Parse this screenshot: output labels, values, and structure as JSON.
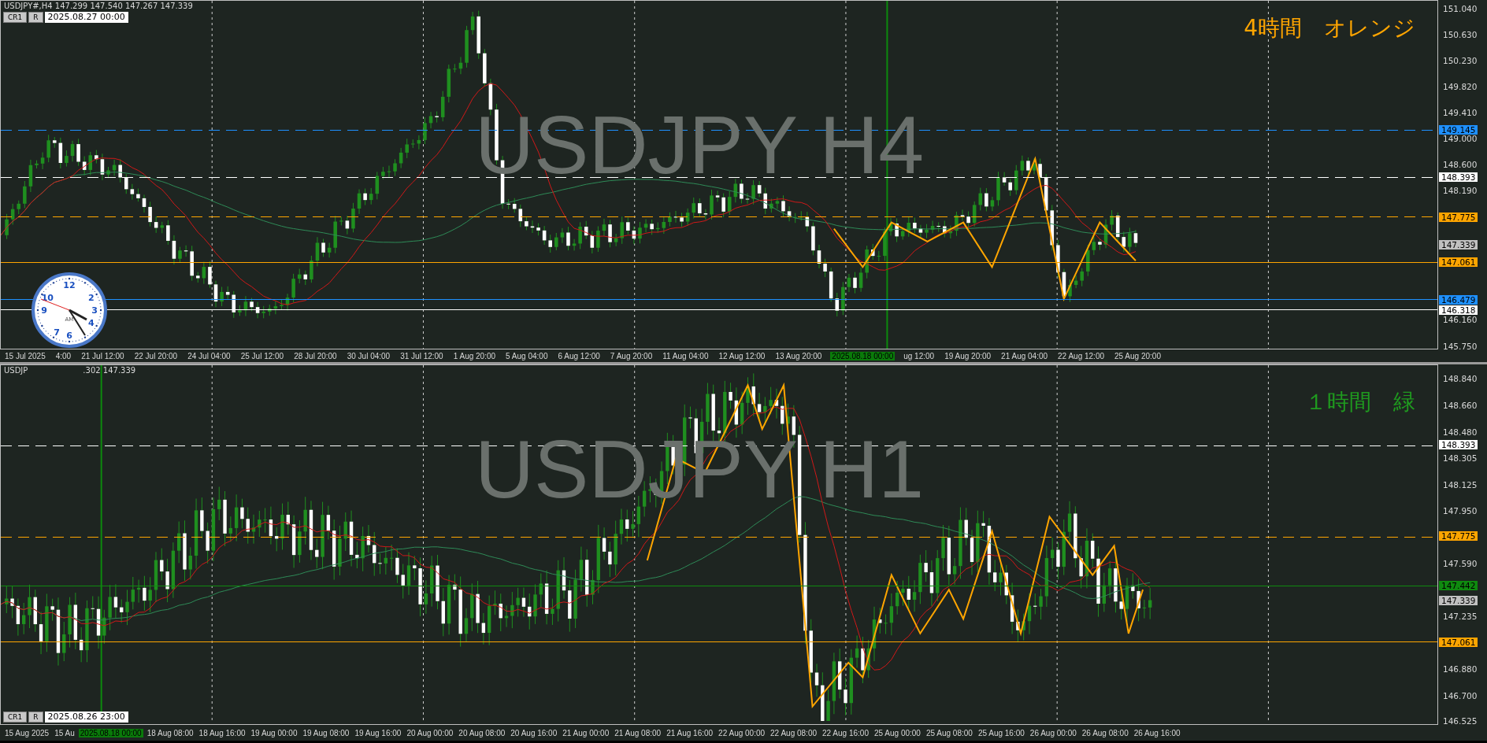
{
  "panels": [
    {
      "header": [
        "USDJPY#,H4  147.299 147.540 147.267 147.339"
      ],
      "watermark": "USDJPY H4",
      "note": {
        "text": "4時間　オレンジ",
        "color": "#ffa500"
      },
      "date_box": {
        "buttons": [
          "CR1",
          "R"
        ],
        "value": "2025.08.27 00:00"
      },
      "price_ticks": [
        "151.040",
        "150.630",
        "150.230",
        "149.820",
        "149.410",
        "149.000",
        "148.600",
        "148.190",
        "146.160",
        "145.750"
      ],
      "levels": [
        {
          "price": "149.145",
          "kind": "dashed",
          "color": "#1e90ff"
        },
        {
          "price": "148.393",
          "kind": "dashed",
          "color": "#ffffff"
        },
        {
          "price": "147.775",
          "kind": "dashed",
          "color": "#ffa500"
        },
        {
          "price": "147.339",
          "kind": "marker",
          "color": "#c0c0c0"
        },
        {
          "price": "147.061",
          "kind": "solid",
          "color": "#ffa500"
        },
        {
          "price": "146.479",
          "kind": "solid",
          "color": "#1e90ff"
        },
        {
          "price": "146.318",
          "kind": "solid",
          "color": "#ffffff"
        }
      ],
      "time_labels": [
        {
          "text": "15 Jul 2025",
          "selected": false
        },
        {
          "text": "4:00",
          "selected": false
        },
        {
          "text": "21 Jul 12:00",
          "selected": false
        },
        {
          "text": "22 Jul 20:00",
          "selected": false
        },
        {
          "text": "24 Jul 04:00",
          "selected": false
        },
        {
          "text": "25 Jul 12:00",
          "selected": false
        },
        {
          "text": "28 Jul 20:00",
          "selected": false
        },
        {
          "text": "30 Jul 04:00",
          "selected": false
        },
        {
          "text": "31 Jul 12:00",
          "selected": false
        },
        {
          "text": "1 Aug 20:00",
          "selected": false
        },
        {
          "text": "5 Aug 04:00",
          "selected": false
        },
        {
          "text": "6 Aug 12:00",
          "selected": false
        },
        {
          "text": "7 Aug 20:00",
          "selected": false
        },
        {
          "text": "11 Aug 04:00",
          "selected": false
        },
        {
          "text": "12 Aug 12:00",
          "selected": false
        },
        {
          "text": "13 Aug 20:00",
          "selected": false
        },
        {
          "text": "2025.08.18 00:00",
          "selected": true
        },
        {
          "text": "ug 12:00",
          "selected": false
        },
        {
          "text": "19 Aug 20:00",
          "selected": false
        },
        {
          "text": "21 Aug 04:00",
          "selected": false
        },
        {
          "text": "22 Aug 12:00",
          "selected": false
        },
        {
          "text": "25 Aug 20:00",
          "selected": false
        }
      ]
    },
    {
      "header": [
        "USDJP",
        ".302 147.339"
      ],
      "watermark": "USDJPY H1",
      "note": {
        "text": "１時間　緑",
        "color": "#1f9a1f"
      },
      "date_box": {
        "buttons": [
          "CR1",
          "R"
        ],
        "value": "2025.08.26 23:00"
      },
      "price_ticks": [
        "148.840",
        "148.660",
        "148.480",
        "148.305",
        "148.125",
        "147.950",
        "147.590",
        "147.235",
        "146.880",
        "146.700",
        "146.525"
      ],
      "levels": [
        {
          "price": "148.393",
          "kind": "dashed",
          "color": "#ffffff"
        },
        {
          "price": "147.775",
          "kind": "dashed",
          "color": "#ffa500"
        },
        {
          "price": "147.442",
          "kind": "solid",
          "color": "#0f8a0f"
        },
        {
          "price": "147.339",
          "kind": "marker",
          "color": "#c0c0c0"
        },
        {
          "price": "147.061",
          "kind": "solid",
          "color": "#ffa500"
        }
      ],
      "time_labels": [
        {
          "text": "15 Aug 2025",
          "selected": false
        },
        {
          "text": "15 Au",
          "selected": false
        },
        {
          "text": "2025.08.18 00:00",
          "selected": true
        },
        {
          "text": "18 Aug 08:00",
          "selected": false
        },
        {
          "text": "18 Aug 16:00",
          "selected": false
        },
        {
          "text": "19 Aug 00:00",
          "selected": false
        },
        {
          "text": "19 Aug 08:00",
          "selected": false
        },
        {
          "text": "19 Aug 16:00",
          "selected": false
        },
        {
          "text": "20 Aug 00:00",
          "selected": false
        },
        {
          "text": "20 Aug 08:00",
          "selected": false
        },
        {
          "text": "20 Aug 16:00",
          "selected": false
        },
        {
          "text": "21 Aug 00:00",
          "selected": false
        },
        {
          "text": "21 Aug 08:00",
          "selected": false
        },
        {
          "text": "21 Aug 16:00",
          "selected": false
        },
        {
          "text": "22 Aug 00:00",
          "selected": false
        },
        {
          "text": "22 Aug 08:00",
          "selected": false
        },
        {
          "text": "22 Aug 16:00",
          "selected": false
        },
        {
          "text": "25 Aug 00:00",
          "selected": false
        },
        {
          "text": "25 Aug 08:00",
          "selected": false
        },
        {
          "text": "25 Aug 16:00",
          "selected": false
        },
        {
          "text": "26 Aug 00:00",
          "selected": false
        },
        {
          "text": "26 Aug 08:00",
          "selected": false
        },
        {
          "text": "26 Aug 16:00",
          "selected": false
        }
      ]
    }
  ],
  "clock": {
    "numerals": [
      "12",
      "2",
      "3",
      "4",
      "6",
      "7",
      "9",
      "10"
    ],
    "period": "AM"
  }
}
